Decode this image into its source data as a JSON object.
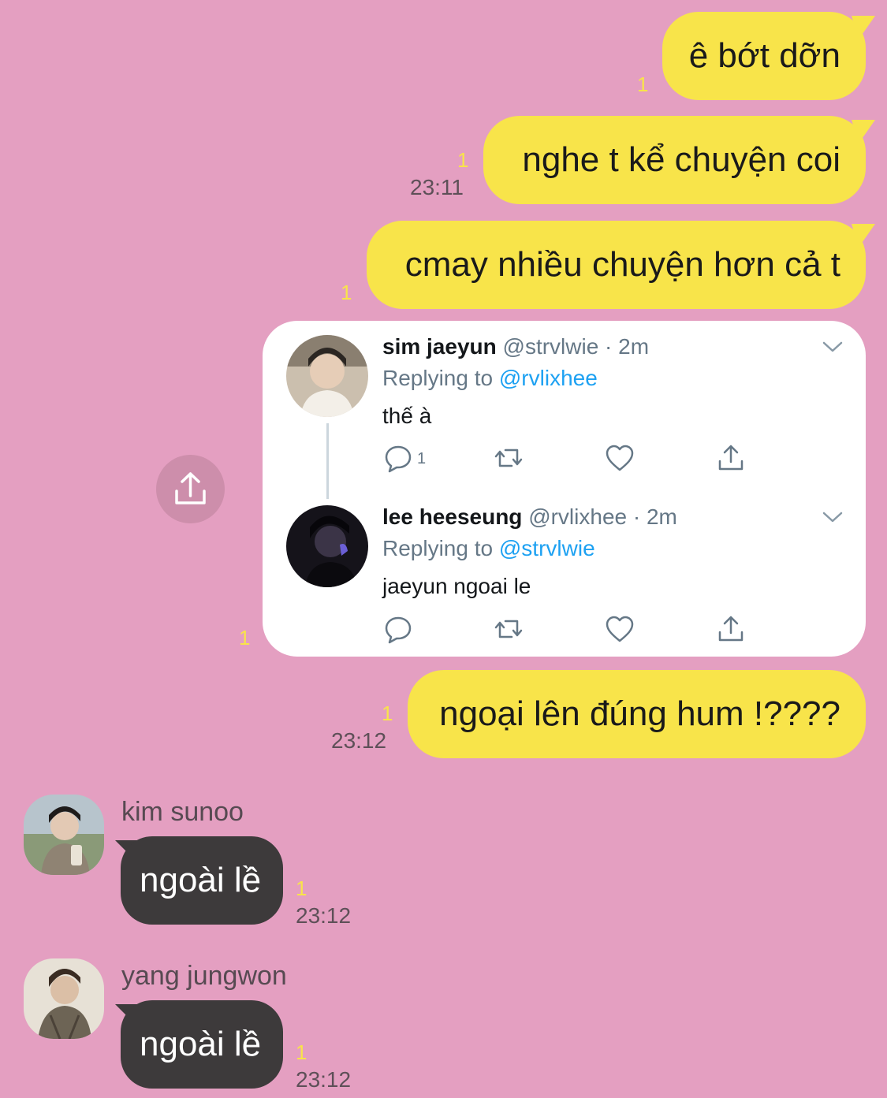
{
  "messages_out": [
    {
      "text": "ê bớt dỡn",
      "unread": "1"
    },
    {
      "text": "nghe t kể chuyện coi",
      "unread": "1",
      "time": "23:11"
    },
    {
      "text": "cmay nhiều chuyện hơn cả t",
      "unread": "1"
    },
    {
      "text": "ngoại lên đúng hum !????",
      "unread": "1",
      "time": "23:12"
    }
  ],
  "tweet_card": {
    "unread": "1",
    "tweets": [
      {
        "display_name": "sim jaeyun",
        "handle": "@strvlwie · 2m",
        "replying_prefix": "Replying to ",
        "replying_to": "@rvlixhee",
        "text": "thế à",
        "reply_count": "1"
      },
      {
        "display_name": "lee heeseung",
        "handle": "@rvlixhee · 2m",
        "replying_prefix": "Replying to ",
        "replying_to": "@strvlwie",
        "text": "jaeyun ngoai le",
        "reply_count": ""
      }
    ]
  },
  "messages_in": [
    {
      "sender": "kim sunoo",
      "text": "ngoài lề",
      "unread": "1",
      "time": "23:12"
    },
    {
      "sender": "yang jungwon",
      "text": "ngoài lề",
      "unread": "1",
      "time": "23:12"
    }
  ],
  "colors": {
    "background": "#e49fc1",
    "outgoing_bubble": "#f8e44a",
    "incoming_bubble": "#3d3a3b",
    "twitter_blue": "#1da1f2"
  }
}
